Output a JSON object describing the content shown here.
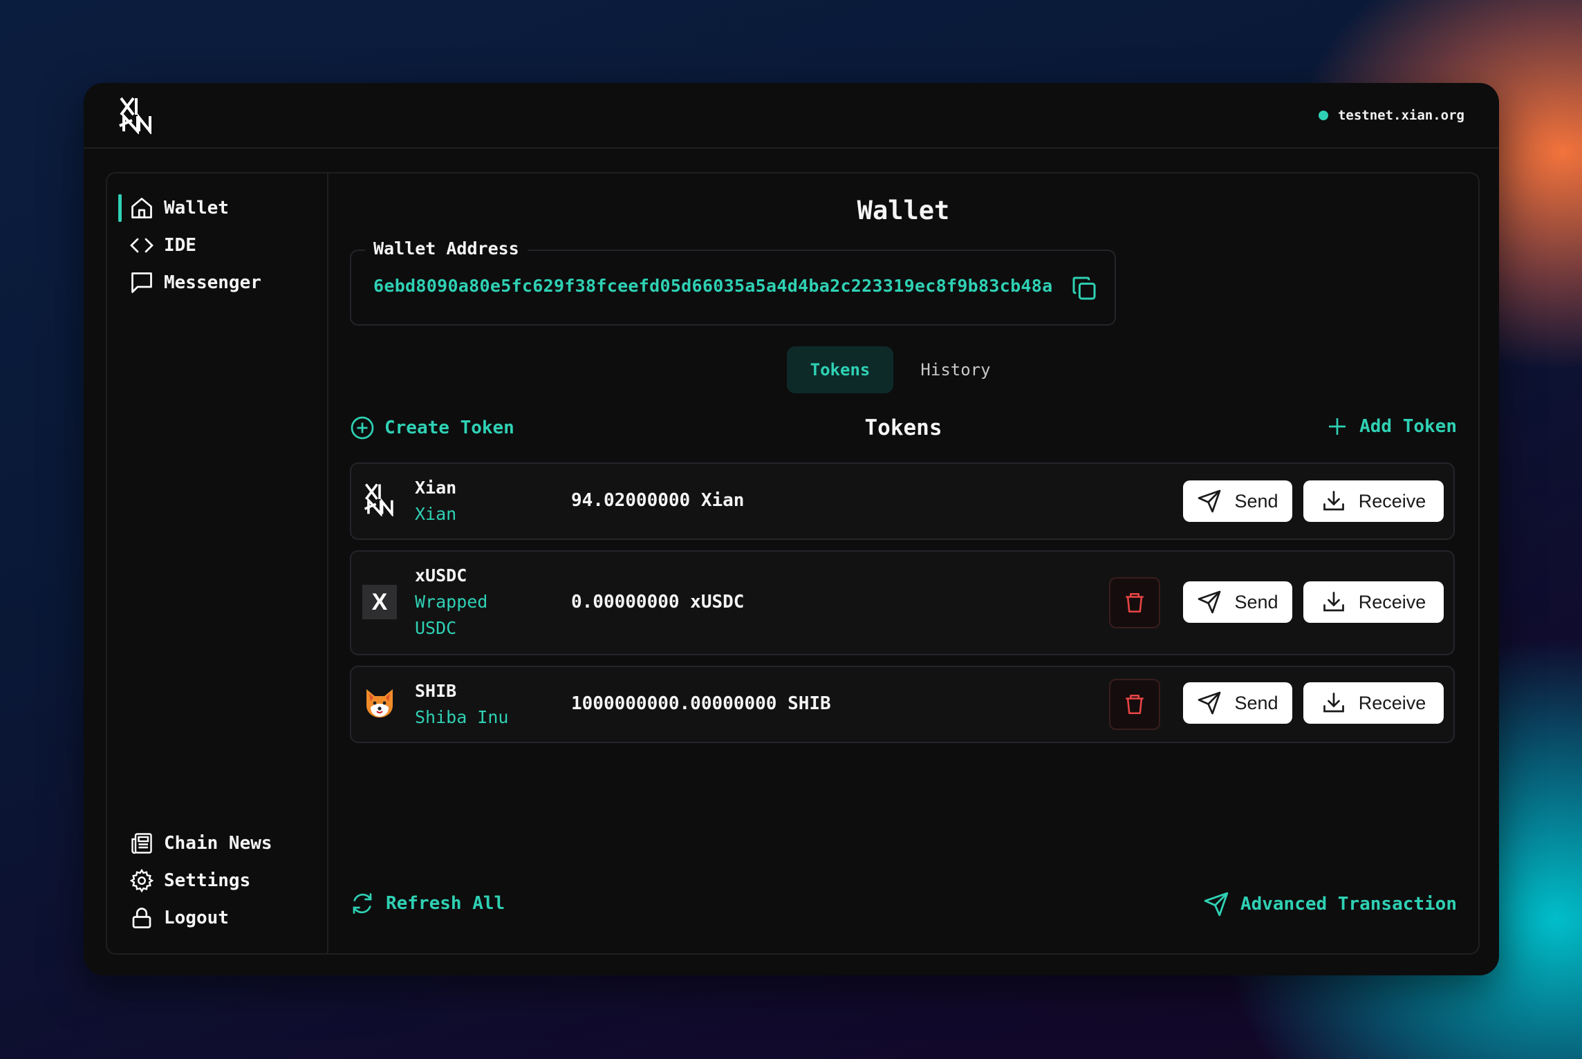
{
  "header": {
    "network": "testnet.xian.org",
    "logo_text": "XN"
  },
  "sidebar": {
    "top_items": [
      {
        "label": "Wallet",
        "icon": "home-icon",
        "active": true
      },
      {
        "label": "IDE",
        "icon": "code-icon"
      },
      {
        "label": "Messenger",
        "icon": "message-icon"
      }
    ],
    "bottom_items": [
      {
        "label": "Chain News",
        "icon": "newspaper-icon"
      },
      {
        "label": "Settings",
        "icon": "gear-icon"
      },
      {
        "label": "Logout",
        "icon": "lock-icon"
      }
    ]
  },
  "main": {
    "title": "Wallet",
    "address_label": "Wallet Address",
    "address": "6ebd8090a80e5fc629f38fceefd05d66035a5a4d4ba2c223319ec8f9b83cb48a",
    "tabs": [
      {
        "label": "Tokens",
        "active": true
      },
      {
        "label": "History",
        "active": false
      }
    ],
    "create_token_label": "Create Token",
    "section_title": "Tokens",
    "add_token_label": "Add Token",
    "send_label": "Send",
    "receive_label": "Receive",
    "tokens": [
      {
        "symbol": "Xian",
        "name": "Xian",
        "balance": "94.02000000 Xian",
        "icon": "xian-logo-icon",
        "deletable": false
      },
      {
        "symbol": "xUSDC",
        "name": "Wrapped USDC",
        "balance": "0.00000000 xUSDC",
        "icon": "x-token-icon",
        "icon_text": "X",
        "deletable": true
      },
      {
        "symbol": "SHIB",
        "name": "Shiba Inu",
        "balance": "1000000000.00000000 SHIB",
        "icon": "shiba-icon",
        "deletable": true
      }
    ],
    "refresh_label": "Refresh All",
    "advanced_label": "Advanced Transaction"
  },
  "colors": {
    "accent": "#2fd1b4",
    "background": "#0d0d0e",
    "danger": "#e84545"
  }
}
